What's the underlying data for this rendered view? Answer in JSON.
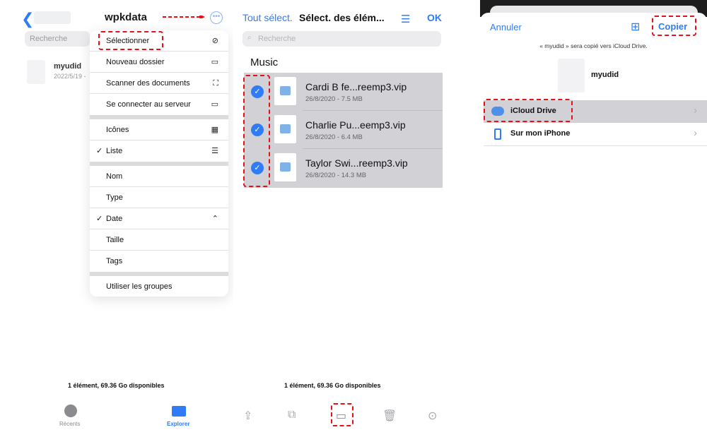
{
  "panel1": {
    "title": "wpkdata",
    "back_icon": "chevron-left-icon",
    "more_icon": "ellipsis-circle-icon",
    "search_placeholder": "Recherche",
    "file": {
      "name": "myudid",
      "date": "2022/5/19 -"
    },
    "menu": {
      "select": "Sélectionner",
      "new_folder": "Nouveau dossier",
      "scan": "Scanner des documents",
      "connect": "Se connecter au serveur",
      "icons": "Icônes",
      "list": "Liste",
      "name": "Nom",
      "type": "Type",
      "date": "Date",
      "size": "Taille",
      "tags": "Tags",
      "groups": "Utiliser les groupes",
      "checkmark": "✓"
    },
    "status": "1 élément, 69.36 Go disponibles",
    "tabs": {
      "recent": "Récents",
      "explore": "Explorer"
    }
  },
  "panel2": {
    "select_all": "Tout sélect.",
    "title": "Sélect. des élém...",
    "ok": "OK",
    "search_placeholder": "Recherche",
    "section": "Music",
    "rows": [
      {
        "name": "Cardi B fe...reemp3.vip",
        "meta": "26/8/2020 - 7.5 MB"
      },
      {
        "name": "Charlie Pu...eemp3.vip",
        "meta": "26/8/2020 - 6.4 MB"
      },
      {
        "name": "Taylor Swi...reemp3.vip",
        "meta": "26/8/2020 - 14.3 MB"
      }
    ],
    "status": "1 élément, 69.36 Go disponibles",
    "toolbar_icons": [
      "share-icon",
      "duplicate-icon",
      "folder-icon",
      "trash-icon",
      "more-icon"
    ]
  },
  "panel3": {
    "cancel": "Annuler",
    "copy": "Copier",
    "message": "« myudid » sera copié vers iCloud Drive.",
    "file_name": "myudid",
    "locations": [
      {
        "label": "iCloud Drive",
        "icon": "icloud-icon"
      },
      {
        "label": "Sur mon iPhone",
        "icon": "iphone-icon"
      }
    ]
  },
  "colors": {
    "accent": "#2f7cf6",
    "highlight": "#e4111b",
    "selected_row": "#d1d1d6"
  }
}
